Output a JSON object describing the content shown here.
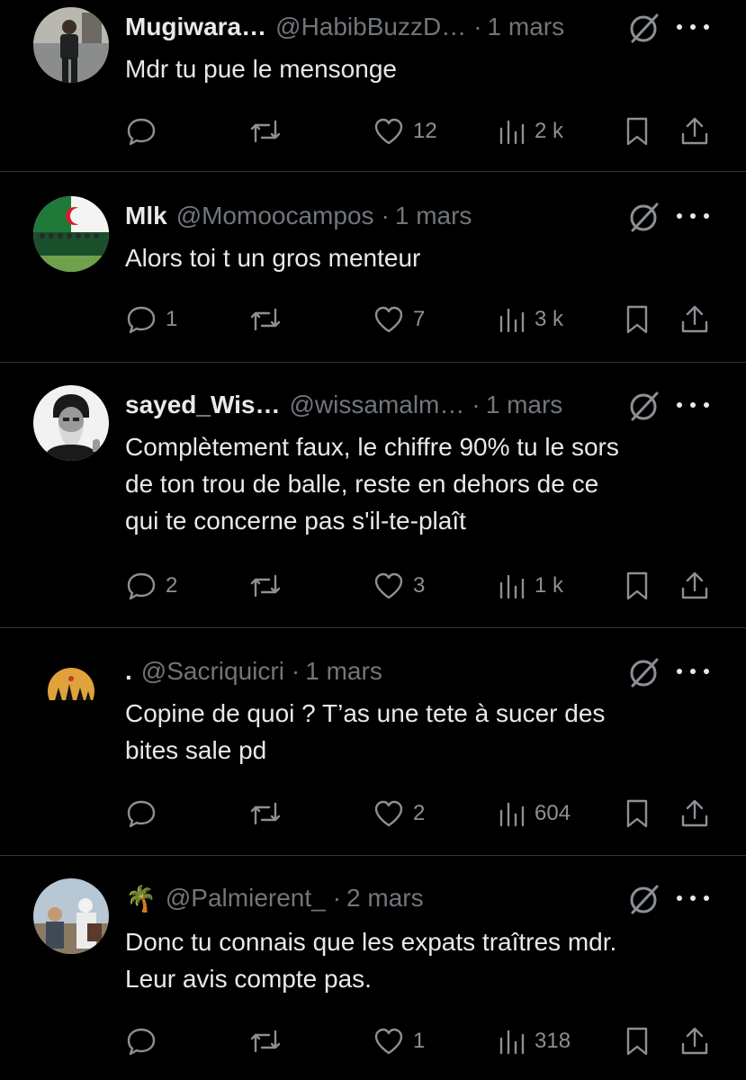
{
  "tweets": [
    {
      "name": "Mugiwara…",
      "handle": "@HabibBuzzD…",
      "separator": "·",
      "date": "1 mars",
      "text": "Mdr tu pue le mensonge",
      "replies": "",
      "likes": "12",
      "views": "2 k",
      "avatar": "avatar-man-standing"
    },
    {
      "name": "Mlk",
      "handle": "@Momoocampos",
      "separator": "·",
      "date": "1 mars",
      "text": "Alors toi t un gros menteur",
      "replies": "1",
      "likes": "7",
      "views": "3 k",
      "avatar": "avatar-team-flag"
    },
    {
      "name": "sayed_Wis…",
      "handle": "@wissamalm…",
      "separator": "·",
      "date": "1 mars",
      "text_lines": [
        "Complètement faux, le chiffre 90% tu le sors",
        "de ton trou de balle, reste en dehors de ce",
        "qui te concerne pas s'il-te-plaît"
      ],
      "replies": "2",
      "likes": "3",
      "views": "1 k",
      "avatar": "avatar-bearded-man"
    },
    {
      "name": ".",
      "handle": "@Sacriquicri",
      "separator": "·",
      "date": "1 mars",
      "text_lines": [
        "Copine de quoi ? T’as une tete à sucer des",
        "bites sale pd"
      ],
      "replies": "",
      "likes": "2",
      "views": "604",
      "avatar": "avatar-sunset-silhouette"
    },
    {
      "name": "🌴",
      "handle": "@Palmierent_",
      "separator": "·",
      "date": "2 mars",
      "text_lines": [
        "Donc tu connais que les expats traîtres mdr.",
        "Leur avis compte pas."
      ],
      "replies": "",
      "likes": "1",
      "views": "318",
      "avatar": "avatar-group-photo"
    }
  ],
  "icons": {
    "reply": "speech-bubble-icon",
    "retweet": "retweet-icon",
    "like": "heart-icon",
    "views": "bar-chart-icon",
    "bookmark": "bookmark-icon",
    "share": "share-icon",
    "grok": "grok-icon",
    "more": "more-dots-icon"
  },
  "colors": {
    "background": "#000000",
    "text": "#e7e9ea",
    "secondary": "#71767b",
    "divider": "#2f3336"
  }
}
